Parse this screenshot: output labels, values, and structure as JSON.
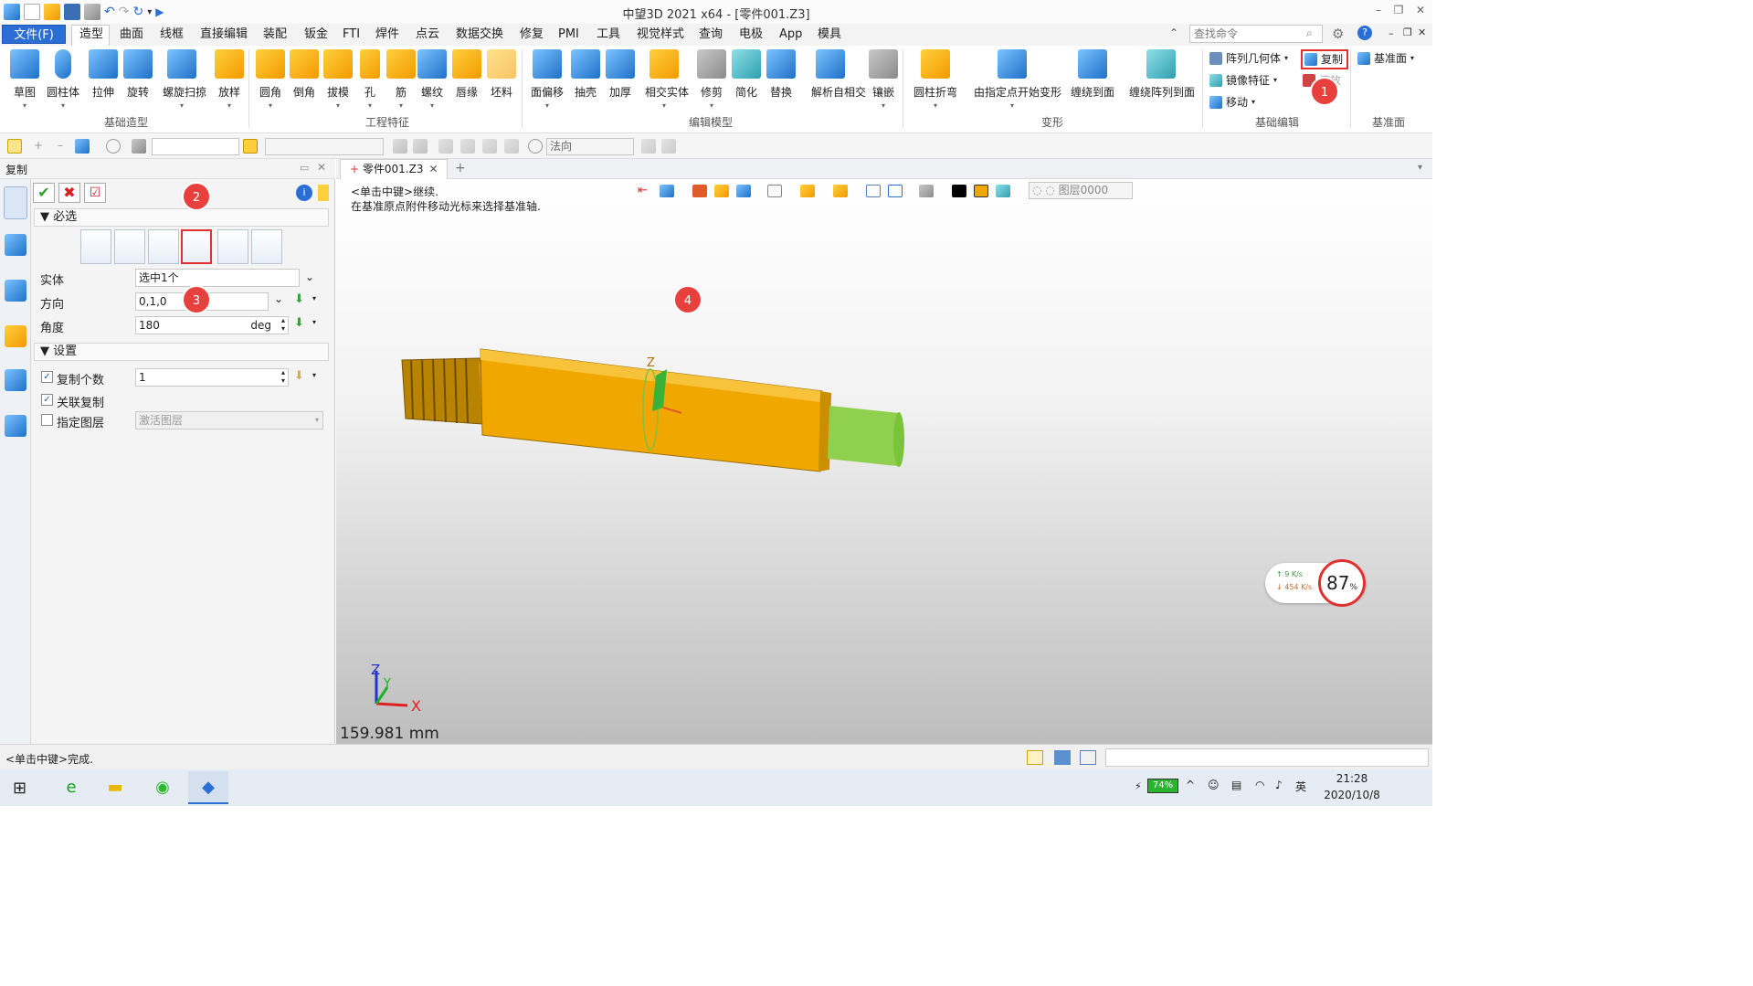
{
  "app": {
    "title": "中望3D 2021 x64 - [零件001.Z3]"
  },
  "menu": {
    "file": "文件(F)",
    "tabs": [
      "造型",
      "曲面",
      "线框",
      "直接编辑",
      "装配",
      "钣金",
      "FTI",
      "焊件",
      "点云",
      "数据交换",
      "修复",
      "PMI",
      "工具",
      "视觉样式",
      "查询",
      "电极",
      "App",
      "模具"
    ],
    "active_tab": "造型",
    "search_placeholder": "查找命令"
  },
  "ribbon": {
    "groups": {
      "basic_shape": {
        "label": "基础造型",
        "buttons": [
          "草图",
          "圆柱体",
          "拉伸",
          "旋转",
          "螺旋扫掠",
          "放样"
        ]
      },
      "engineering": {
        "label": "工程特征",
        "buttons": [
          "圆角",
          "倒角",
          "拔模",
          "孔",
          "筋",
          "螺纹",
          "唇缘",
          "坯料"
        ]
      },
      "edit_model": {
        "label": "编辑模型",
        "buttons": [
          "面偏移",
          "抽壳",
          "加厚",
          "相交实体",
          "修剪",
          "简化",
          "替换",
          "解析自相交",
          "镶嵌"
        ]
      },
      "deform": {
        "label": "变形",
        "buttons": [
          "圆柱折弯",
          "由指定点开始变形",
          "缠绕到面",
          "缠绕阵列到面"
        ]
      },
      "basic_edit": {
        "label": "基础编辑",
        "items": [
          "阵列几何体",
          "镜像特征",
          "移动",
          "复制",
          "缩放"
        ]
      },
      "datum": {
        "label": "基准面",
        "items": [
          "基准面"
        ]
      }
    }
  },
  "toolbar2": {
    "combo1": "",
    "combo2": "",
    "direction_combo": "法向"
  },
  "panel": {
    "title": "复制",
    "required_section": "必选",
    "settings_section": "设置",
    "fields": {
      "entity_label": "实体",
      "entity_value": "选中1个",
      "direction_label": "方向",
      "direction_value": "0,1,0",
      "angle_label": "角度",
      "angle_value": "180",
      "angle_unit": "deg"
    },
    "settings": {
      "copy_count_label": "复制个数",
      "copy_count_value": "1",
      "copy_count_checked": true,
      "linked_copy_label": "关联复制",
      "linked_copy_checked": true,
      "layer_label": "指定图层",
      "layer_checked": false,
      "layer_value": "激活图层"
    }
  },
  "document": {
    "tab": "零件001.Z3"
  },
  "viewport": {
    "prompt_line1": "<单击中键>继续.",
    "prompt_line2": "在基准原点附件移动光标来选择基准轴.",
    "layer": "图层0000",
    "measure": "159.981 mm",
    "axis_x": "X",
    "axis_y": "Y",
    "axis_z": "Z",
    "gizmo_z": "Z"
  },
  "badges": [
    "1",
    "2",
    "3",
    "4"
  ],
  "netmeter": {
    "up": "9  K/s",
    "down": "454 K/s",
    "percent": "87",
    "unit": "%"
  },
  "status": {
    "text": "<单击中键>完成."
  },
  "taskbar": {
    "battery": "74%",
    "time": "21:28",
    "date": "2020/10/8"
  },
  "colors": {
    "accent": "#2b6fd6",
    "part": "#f0a800",
    "badge": "#e8403c",
    "highlight": "#e03030"
  }
}
